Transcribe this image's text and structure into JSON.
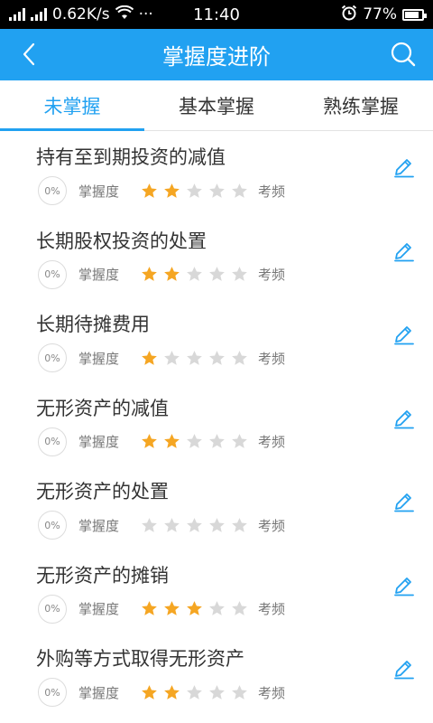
{
  "status_bar": {
    "left": "0.62K/s",
    "time": "11:40",
    "dots": "···",
    "battery": "77%"
  },
  "header": {
    "title": "掌握度进阶",
    "back_icon": "chevron-left-icon",
    "search_icon": "search-icon"
  },
  "tabs": [
    {
      "label": "未掌握",
      "active": true
    },
    {
      "label": "基本掌握",
      "active": false
    },
    {
      "label": "熟练掌握",
      "active": false
    }
  ],
  "colors": {
    "accent": "#21a1f1",
    "star_on": "#f5a623",
    "star_off": "#d8d8d8"
  },
  "list": {
    "mastery_label": "掌握度",
    "frequency_label": "考频",
    "items": [
      {
        "title": "持有至到期投资的减值",
        "percent": "0%",
        "stars": 2
      },
      {
        "title": "长期股权投资的处置",
        "percent": "0%",
        "stars": 2
      },
      {
        "title": "长期待摊费用",
        "percent": "0%",
        "stars": 1
      },
      {
        "title": "无形资产的减值",
        "percent": "0%",
        "stars": 2
      },
      {
        "title": "无形资产的处置",
        "percent": "0%",
        "stars": 0
      },
      {
        "title": "无形资产的摊销",
        "percent": "0%",
        "stars": 3
      },
      {
        "title": "外购等方式取得无形资产",
        "percent": "0%",
        "stars": 2
      }
    ]
  }
}
